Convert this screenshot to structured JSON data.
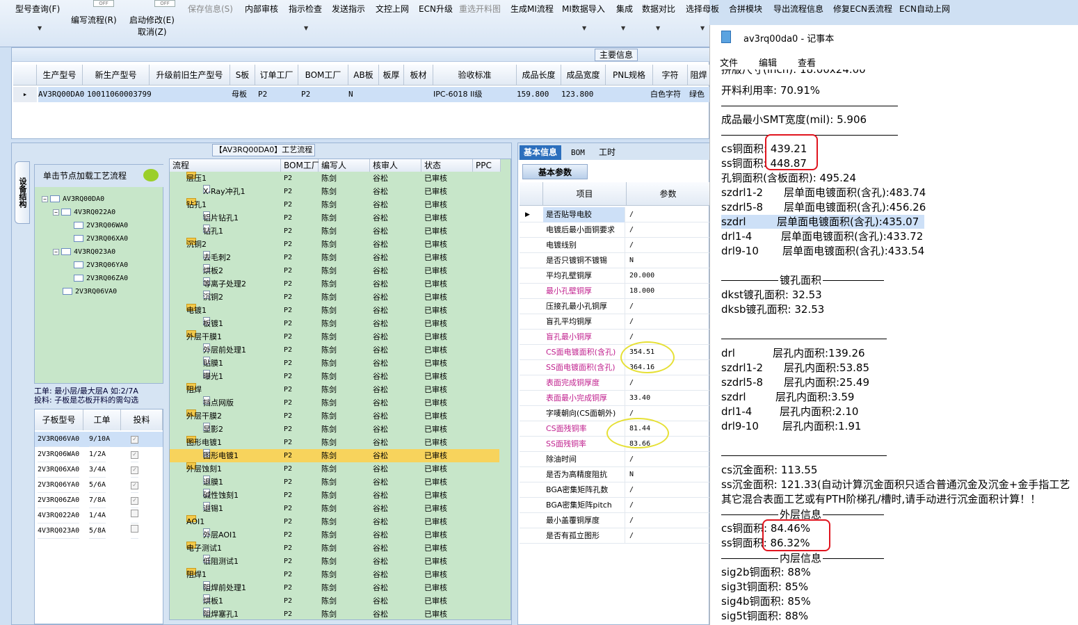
{
  "toolbar": {
    "items": [
      "型号查询(F)",
      "编写流程(R)",
      "启动修改(E)",
      "取消(Z)",
      "保存信息(S)",
      "内部审核",
      "指示检查",
      "发送指示",
      "文控上网",
      "ECN升级",
      "重选开料图",
      "生成MI流程",
      "MI数据导入",
      "集成",
      "数据对比",
      "选择母板",
      "合拼模块",
      "导出流程信息",
      "修复ECN丢流程",
      "ECN自动上网"
    ],
    "toggle": "OFF"
  },
  "main_section": {
    "title": "主要信息",
    "columns": [
      "生产型号",
      "新生产型号",
      "升级前旧生产型号",
      "S板",
      "订单工厂",
      "BOM工厂",
      "AB板",
      "板厚",
      "板材",
      "验收标准",
      "成品长度",
      "成品宽度",
      "PNL规格",
      "字符",
      "阻焊"
    ],
    "row": [
      "AV3RQ00DA0",
      "10011060003799",
      "",
      "母板",
      "P2",
      "P2",
      "N",
      "",
      "",
      "IPC-6018 II级",
      "159.800",
      "123.800",
      "",
      "白色字符",
      "绿色"
    ]
  },
  "process": {
    "title": "【AV3RQ00DA0】工艺流程",
    "side_tab": "设备结构",
    "tree_header": "单击节点加载工艺流程",
    "tree": [
      "AV3RQ00DA0",
      "4V3RQ022A0",
      "2V3RQ06WA0",
      "2V3RQ06XA0",
      "4V3RQ023A0",
      "2V3RQ06YA0",
      "2V3RQ06ZA0",
      "2V3RQ06VA0"
    ],
    "info1": "工单: 最小层/最大层A 如:2/7A",
    "info2": "投料: 子板是芯板开料的需勾选",
    "sub_columns": [
      "子板型号",
      "工单",
      "投料"
    ],
    "sub_rows": [
      [
        "2V3RQ06VA0",
        "9/10A",
        true
      ],
      [
        "2V3RQ06WA0",
        "1/2A",
        true
      ],
      [
        "2V3RQ06XA0",
        "3/4A",
        true
      ],
      [
        "2V3RQ06YA0",
        "5/6A",
        true
      ],
      [
        "2V3RQ06ZA0",
        "7/8A",
        true
      ],
      [
        "4V3RQ022A0",
        "1/4A",
        false
      ],
      [
        "4V3RQ023A0",
        "5/8A",
        false
      ]
    ],
    "flow_columns": [
      "流程",
      "BOM工厂",
      "编写人",
      "核审人",
      "状态",
      "PPC"
    ],
    "flow_rows": [
      {
        "name": "层压1",
        "folder": true
      },
      {
        "name": "X-Ray冲孔1",
        "folder": false
      },
      {
        "name": "钻孔1",
        "folder": true
      },
      {
        "name": "铝片钻孔1",
        "folder": false
      },
      {
        "name": "钻孔1",
        "folder": false
      },
      {
        "name": "沉铜2",
        "folder": true
      },
      {
        "name": "去毛刺2",
        "folder": false
      },
      {
        "name": "烘板2",
        "folder": false
      },
      {
        "name": "等离子处理2",
        "folder": false
      },
      {
        "name": "沉铜2",
        "folder": false
      },
      {
        "name": "电镀1",
        "folder": true
      },
      {
        "name": "板镀1",
        "folder": false
      },
      {
        "name": "外层干膜1",
        "folder": true
      },
      {
        "name": "外层前处理1",
        "folder": false
      },
      {
        "name": "贴膜1",
        "folder": false
      },
      {
        "name": "曝光1",
        "folder": false
      },
      {
        "name": "阻焊",
        "folder": true
      },
      {
        "name": "挡点网版",
        "folder": false
      },
      {
        "name": "外层干膜2",
        "folder": true
      },
      {
        "name": "显影2",
        "folder": false
      },
      {
        "name": "图形电镀1",
        "folder": true
      },
      {
        "name": "图形电镀1",
        "folder": false,
        "selected": true
      },
      {
        "name": "外层蚀刻1",
        "folder": true
      },
      {
        "name": "退膜1",
        "folder": false
      },
      {
        "name": "碱性蚀刻1",
        "folder": false
      },
      {
        "name": "退锡1",
        "folder": false
      },
      {
        "name": "AOI1",
        "folder": true
      },
      {
        "name": "外层AOI1",
        "folder": false
      },
      {
        "name": "电子测试1",
        "folder": true
      },
      {
        "name": "低阻测试1",
        "folder": false
      },
      {
        "name": "阻焊1",
        "folder": true
      },
      {
        "name": "阻焊前处理1",
        "folder": false
      },
      {
        "name": "烘板1",
        "folder": false
      },
      {
        "name": "阻焊塞孔1",
        "folder": false
      }
    ],
    "flow_common": {
      "bom": "P2",
      "writer": "陈剑",
      "reviewer": "谷松",
      "status": "已审核"
    }
  },
  "right": {
    "tabs": [
      "基本信息",
      "BOM",
      "工时"
    ],
    "subtab": "基本参数",
    "columns": [
      "项目",
      "参数"
    ],
    "rows": [
      {
        "k": "是否贴导电胶",
        "v": "/",
        "pink": false
      },
      {
        "k": "电镀后最小面铜要求",
        "v": "/",
        "pink": false
      },
      {
        "k": "电镀线别",
        "v": "/",
        "pink": false
      },
      {
        "k": "是否只镀铜不镀锡",
        "v": "N",
        "pink": false
      },
      {
        "k": "平均孔壁铜厚",
        "v": "20.000",
        "pink": false
      },
      {
        "k": "最小孔壁铜厚",
        "v": "18.000",
        "pink": true
      },
      {
        "k": "压接孔最小孔铜厚",
        "v": "/",
        "pink": false
      },
      {
        "k": "盲孔平均铜厚",
        "v": "/",
        "pink": false
      },
      {
        "k": "盲孔最小铜厚",
        "v": "/",
        "pink": true
      },
      {
        "k": "CS面电镀面积(含孔)",
        "v": "354.51",
        "pink": true
      },
      {
        "k": "SS面电镀面积(含孔)",
        "v": "364.16",
        "pink": true
      },
      {
        "k": "表面完成铜厚度",
        "v": "/",
        "pink": true
      },
      {
        "k": "表面最小完成铜厚",
        "v": "33.40",
        "pink": true
      },
      {
        "k": "字唛朝向(CS面朝外)",
        "v": "/",
        "pink": false
      },
      {
        "k": "CS面残铜率",
        "v": "81.44",
        "pink": true
      },
      {
        "k": "SS面残铜率",
        "v": "83.66",
        "pink": true
      },
      {
        "k": "除油时间",
        "v": "/",
        "pink": false
      },
      {
        "k": "是否为高精度阻抗",
        "v": "N",
        "pink": false
      },
      {
        "k": "BGA密集矩阵孔数",
        "v": "/",
        "pink": false
      },
      {
        "k": "BGA密集矩阵pitch",
        "v": "/",
        "pink": false
      },
      {
        "k": "最小盖覆铜厚度",
        "v": "/",
        "pink": false
      },
      {
        "k": "是否有孤立图形",
        "v": "/",
        "pink": false
      }
    ]
  },
  "notepad": {
    "title": "av3rq00da0 - 记事本",
    "menu": [
      "文件",
      "编辑",
      "查看"
    ],
    "lines": {
      "l0": "拼版尺寸(inch): 18.00x24.00",
      "l1": "开料利用率: 70.91%",
      "l2": "成品最小SMT宽度(mil): 5.906",
      "l3": "cs铜面积: 439.21",
      "l4": "ss铜面积: 448.87",
      "l5": "孔铜面积(含板面积): 495.24",
      "l6a": "szdrl1-2",
      "l6b": "层单面电镀面积(含孔):483.74",
      "l7a": "szdrl5-8",
      "l7b": "层单面电镀面积(含孔):456.26",
      "l8a": "szdrl",
      "l8b": "层单面电镀面积(含孔):435.07",
      "l9a": "drl1-4",
      "l9b": "层单面电镀面积(含孔):433.72",
      "l10a": "drl9-10",
      "l10b": "层单面电镀面积(含孔):433.54",
      "sec1": "镀孔面积",
      "l11": "dkst镀孔面积: 32.53",
      "l12": "dksb镀孔面积: 32.53",
      "l13a": "drl",
      "l13b": "层孔内面积:139.26",
      "l14a": "szdrl1-2",
      "l14b": "层孔内面积:53.85",
      "l15a": "szdrl5-8",
      "l15b": "层孔内面积:25.49",
      "l16a": "szdrl",
      "l16b": "层孔内面积:3.59",
      "l17a": "drl1-4",
      "l17b": "层孔内面积:2.10",
      "l18a": "drl9-10",
      "l18b": "层孔内面积:1.91",
      "l19": "cs沉金面积: 113.55",
      "l20": "ss沉金面积: 121.33(自动计算沉金面积只适合普通沉金及沉金+金手指工艺",
      "l21": "其它混合表面工艺或有PTH阶梯孔/槽时,请手动进行沉金面积计算！！",
      "sec2": "外层信息",
      "l22": "cs铜面积: 84.46%",
      "l23": "ss铜面积: 86.32%",
      "sec3": "内层信息",
      "l24": "sig2b铜面积: 88%",
      "l25": "sig3t铜面积: 85%",
      "l26": "sig4b铜面积: 85%",
      "l27": "sig5t铜面积: 88%"
    }
  }
}
